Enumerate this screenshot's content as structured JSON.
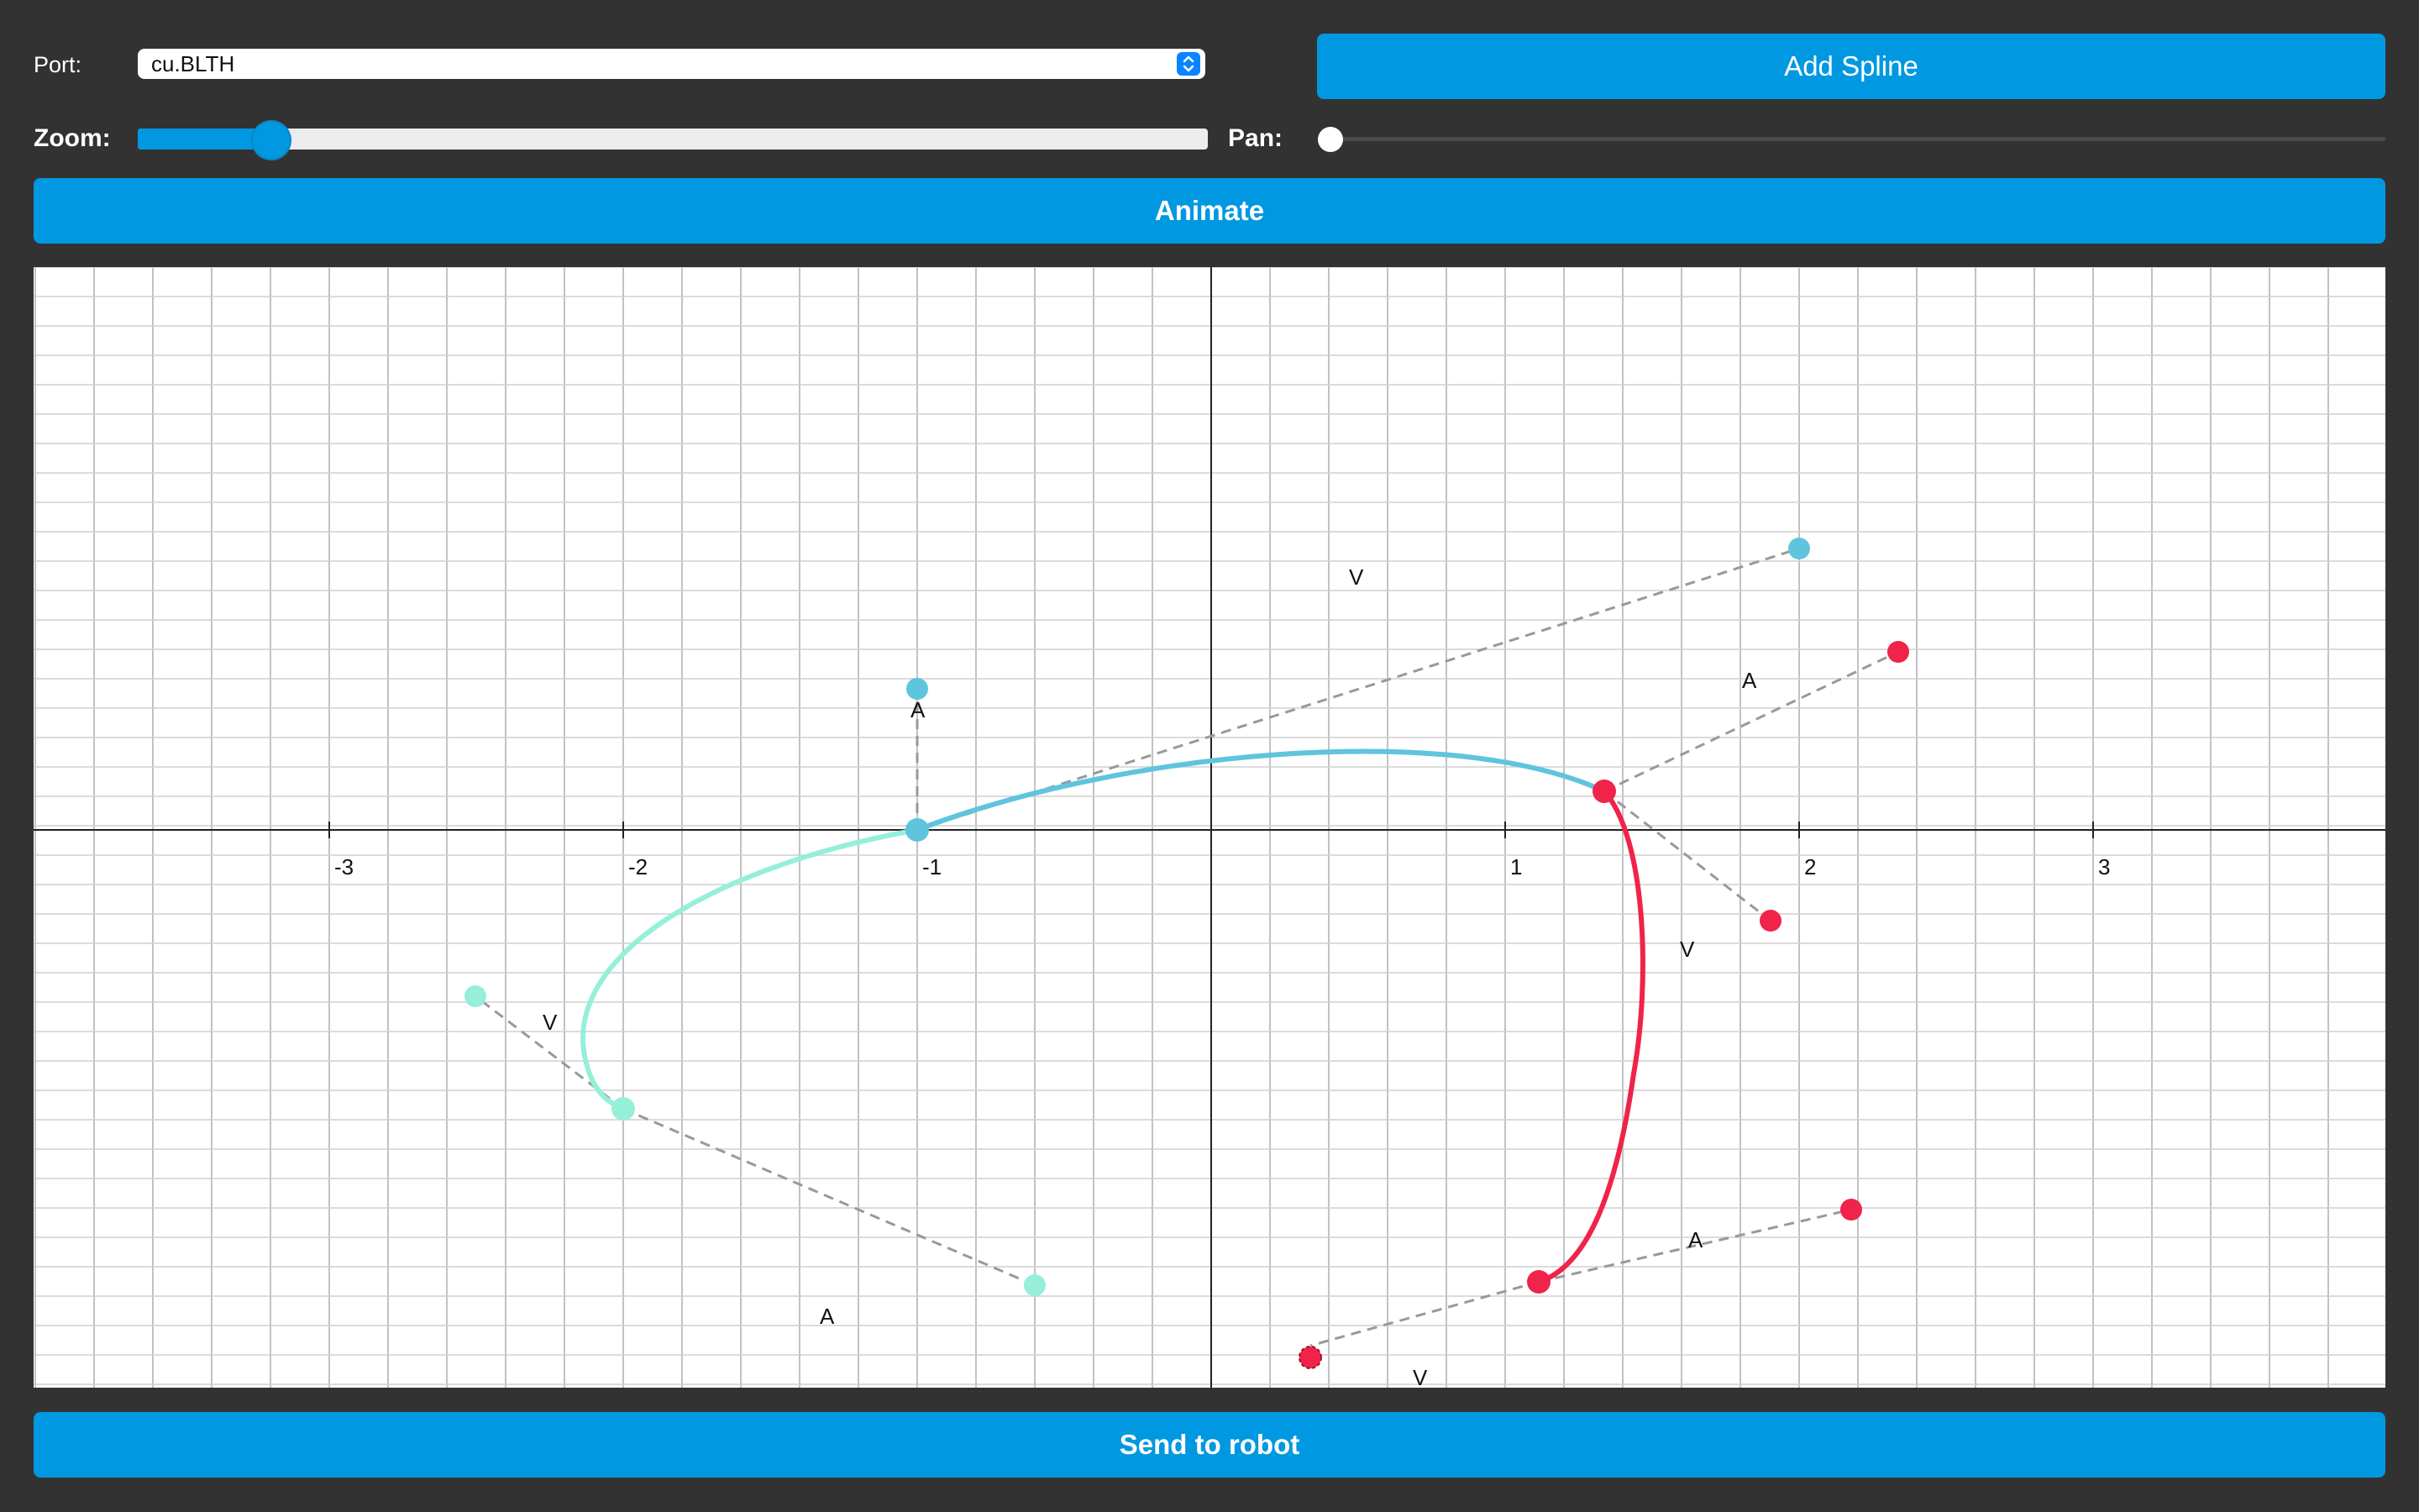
{
  "port": {
    "label": "Port:",
    "value": "cu.BLTH"
  },
  "toolbar": {
    "add_spline_label": "Add Spline",
    "animate_label": "Animate",
    "send_label": "Send to robot"
  },
  "zoom": {
    "label": "Zoom:",
    "value_fraction": 0.13
  },
  "pan": {
    "label": "Pan:",
    "value_fraction": 0.0
  },
  "colors": {
    "background": "#323232",
    "button": "#0098e0",
    "spline_cyan": "#5fc4dd",
    "spline_mint": "#96efd9",
    "spline_red": "#f0234a",
    "handle_line": "#999999"
  },
  "graph": {
    "x_ticks": [
      "-3",
      "-2",
      "-1",
      "1",
      "2",
      "3"
    ],
    "handle_labels": [
      "V",
      "A",
      "V",
      "A",
      "V",
      "A",
      "V",
      "A"
    ]
  }
}
